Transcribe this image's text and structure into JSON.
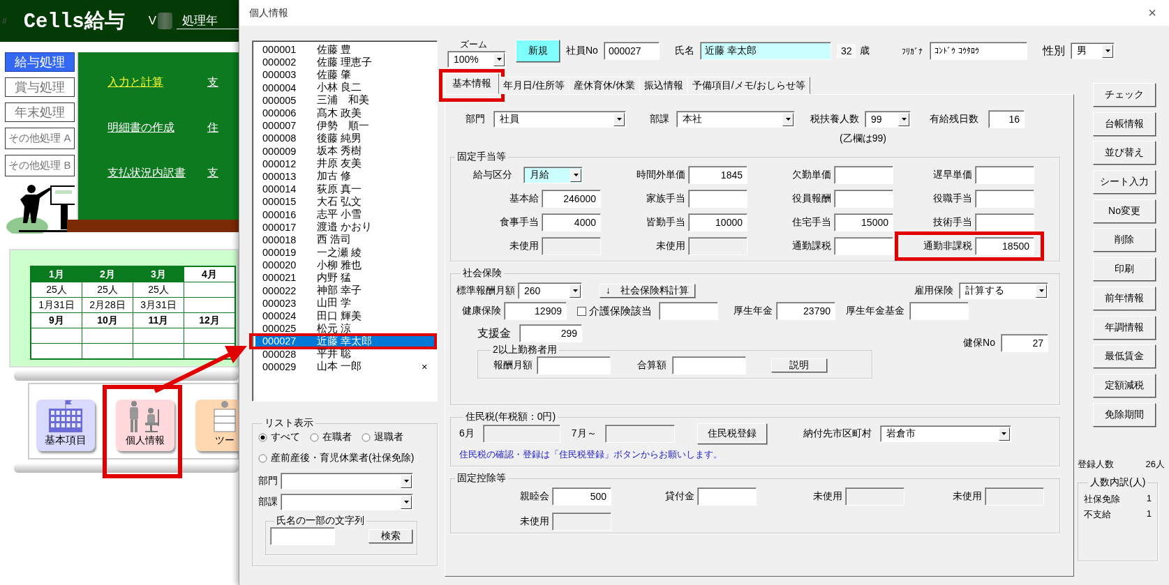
{
  "background_app": {
    "corner_mark": "#",
    "title": "Cells給与",
    "version": "V",
    "year_label": "処理年",
    "menu": [
      {
        "label": "給与処理",
        "selected": true
      },
      {
        "label": "賞与処理",
        "selected": false
      },
      {
        "label": "年末処理",
        "selected": false
      },
      {
        "label": "その他処理 A",
        "selected": false
      },
      {
        "label": "その他処理 B",
        "selected": false
      }
    ],
    "board_links": [
      {
        "label": "入力と計算",
        "selected": true
      },
      {
        "label": "支",
        "selected": false
      },
      {
        "label": "明細書の作成",
        "selected": false
      },
      {
        "label": "住",
        "selected": false
      },
      {
        "label": "支払状況内訳書",
        "selected": false
      },
      {
        "label": "支",
        "selected": false
      }
    ],
    "calendar": {
      "blocks": [
        {
          "months": [
            {
              "label": "1月",
              "done": true
            },
            {
              "label": "2月",
              "done": true
            },
            {
              "label": "3月",
              "done": true
            },
            {
              "label": "4月",
              "done": false
            }
          ],
          "rows": [
            [
              "25人",
              "25人",
              "25人",
              null
            ],
            [
              "1月31日",
              "2月28日",
              "3月31日",
              null
            ]
          ]
        },
        {
          "months": [
            {
              "label": "9月",
              "done": false
            },
            {
              "label": "10月",
              "done": false
            },
            {
              "label": "11月",
              "done": false
            },
            {
              "label": "12月",
              "done": false
            }
          ],
          "rows": [
            [
              null,
              null,
              null,
              null
            ],
            [
              null,
              null,
              null,
              null
            ]
          ]
        }
      ]
    },
    "tiles": [
      {
        "label": "基本項目",
        "kind": "building",
        "annotated": false
      },
      {
        "label": "個人情報",
        "kind": "people",
        "annotated": true
      },
      {
        "label": "ツー",
        "kind": "worker",
        "annotated": false
      }
    ]
  },
  "dialog": {
    "title": "個人情報",
    "close": "×",
    "zoom": {
      "label": "ズーム",
      "value": "100%"
    },
    "new_button": "新規",
    "employee_no": {
      "label": "社員No",
      "value": "000027"
    },
    "name": {
      "label": "氏名",
      "value": "近藤 幸太郎"
    },
    "age": {
      "value": "32",
      "unit": "歳"
    },
    "furigana": {
      "label": "ﾌﾘｶﾞﾅ",
      "value": "ｺﾝﾄﾞｳ ｺｳﾀﾛｳ"
    },
    "gender": {
      "label": "性別",
      "value": "男"
    },
    "employee_list": {
      "selection_annotated": true,
      "items": [
        {
          "no": "000001",
          "name": "佐藤 豊",
          "selected": false
        },
        {
          "no": "000002",
          "name": "佐藤 理恵子",
          "selected": false
        },
        {
          "no": "000003",
          "name": "佐藤 肇",
          "selected": false
        },
        {
          "no": "000004",
          "name": "小林 良二",
          "selected": false
        },
        {
          "no": "000005",
          "name": "三浦　和美",
          "selected": false
        },
        {
          "no": "000006",
          "name": "髙木 政美",
          "selected": false
        },
        {
          "no": "000007",
          "name": "伊勢　順一",
          "selected": false
        },
        {
          "no": "000008",
          "name": "後藤 純男",
          "selected": false
        },
        {
          "no": "000009",
          "name": "坂本 秀樹",
          "selected": false
        },
        {
          "no": "000012",
          "name": "井原 友美",
          "selected": false
        },
        {
          "no": "000013",
          "name": "加古 修",
          "selected": false
        },
        {
          "no": "000014",
          "name": "荻原 真一",
          "selected": false
        },
        {
          "no": "000015",
          "name": "大石 弘文",
          "selected": false
        },
        {
          "no": "000016",
          "name": "志平 小雪",
          "selected": false
        },
        {
          "no": "000017",
          "name": "渡邉 かおり",
          "selected": false
        },
        {
          "no": "000018",
          "name": "西 浩司",
          "selected": false
        },
        {
          "no": "000019",
          "name": "一之瀬 綾",
          "selected": false
        },
        {
          "no": "000020",
          "name": "小柳 雅也",
          "selected": false
        },
        {
          "no": "000021",
          "name": "内野 猛",
          "selected": false
        },
        {
          "no": "000022",
          "name": "神部 幸子",
          "selected": false
        },
        {
          "no": "000023",
          "name": "山田 学",
          "selected": false
        },
        {
          "no": "000024",
          "name": "田口 輝美",
          "selected": false
        },
        {
          "no": "000025",
          "name": "松元 涼",
          "selected": false
        },
        {
          "no": "000027",
          "name": "近藤 幸太郎",
          "selected": true
        },
        {
          "no": "000028",
          "name": "平井 聡",
          "selected": false
        },
        {
          "no": "000029",
          "name": "山本 一郎",
          "mark": "×",
          "selected": false
        }
      ]
    },
    "list_filter": {
      "title": "リスト表示",
      "options": [
        {
          "label": "すべて",
          "selected": true
        },
        {
          "label": "在職者",
          "selected": false
        },
        {
          "label": "退職者",
          "selected": false
        },
        {
          "label": "産前産後・育児休業者(社保免除)",
          "selected": false
        }
      ],
      "department_label": "部門",
      "section_label": "部課",
      "search_title": "氏名の一部の文字列",
      "search_button": "検索"
    },
    "tabs": [
      {
        "label": "基本情報",
        "selected": true,
        "annotated": true
      },
      {
        "label": "年月日/住所等",
        "selected": false,
        "annotated": false
      },
      {
        "label": "産休育休/休業",
        "selected": false,
        "annotated": false
      },
      {
        "label": "振込情報",
        "selected": false,
        "annotated": false
      },
      {
        "label": "予備項目/メモ/おしらせ等",
        "selected": false,
        "annotated": false
      }
    ],
    "basic": {
      "department": {
        "label": "部門",
        "value": "社員"
      },
      "section": {
        "label": "部課",
        "value": "本社"
      },
      "dependents": {
        "label": "税扶養人数",
        "value": "99"
      },
      "paid_leave": {
        "label": "有給残日数",
        "value": "16"
      },
      "dependents_note": "(乙欄は99)"
    },
    "allowances": {
      "title": "固定手当等",
      "pay_type": {
        "label": "給与区分",
        "value": "月給"
      },
      "fields": [
        {
          "label": "時間外単価",
          "value": "1845",
          "kind": "input",
          "annotated": false
        },
        {
          "label": "欠勤単価",
          "kind": "input",
          "annotated": false
        },
        {
          "label": "遅早単価",
          "kind": "input",
          "annotated": false
        },
        {
          "label": "基本給",
          "value": "246000",
          "kind": "input",
          "annotated": false
        },
        {
          "label": "家族手当",
          "kind": "input",
          "annotated": false
        },
        {
          "label": "役員報酬",
          "kind": "input",
          "annotated": false
        },
        {
          "label": "役職手当",
          "kind": "input",
          "annotated": false
        },
        {
          "label": "食事手当",
          "value": "4000",
          "kind": "input",
          "annotated": false
        },
        {
          "label": "皆勤手当",
          "value": "10000",
          "kind": "input",
          "annotated": false
        },
        {
          "label": "住宅手当",
          "value": "15000",
          "kind": "input",
          "annotated": false
        },
        {
          "label": "技術手当",
          "kind": "input",
          "annotated": false
        },
        {
          "label": "未使用",
          "kind": "disabled",
          "annotated": false
        },
        {
          "label": "未使用",
          "kind": "disabled",
          "annotated": false
        },
        {
          "label": "通勤課税",
          "kind": "input",
          "annotated": false
        },
        {
          "label": "通勤非課税",
          "value": "18500",
          "kind": "input",
          "annotated": true
        }
      ]
    },
    "social_insurance": {
      "title": "社会保険",
      "standard_pay": {
        "label": "標準報酬月額",
        "value": "260"
      },
      "calc_button": "↓　社会保険料計算",
      "employment": {
        "label": "雇用保険",
        "value": "計算する"
      },
      "health": {
        "label": "健康保険",
        "value": "12909"
      },
      "care": {
        "label": "介護保険該当",
        "checked": false
      },
      "pension": {
        "label": "厚生年金",
        "value": "23790"
      },
      "pension_fund": {
        "label": "厚生年金基金"
      },
      "support": {
        "label": "支援金",
        "value": "299"
      },
      "insurer_no": {
        "label": "健保No",
        "value": "27"
      },
      "multi_work": {
        "title": "2以上勤務者用",
        "pay_label": "報酬月額",
        "total_label": "合算額",
        "button": "説明"
      }
    },
    "resident_tax": {
      "title": "住民税(年税額：0円)",
      "june_label": "6月",
      "july_label": "7月～",
      "button": "住民税登録",
      "city": {
        "label": "納付先市区町村",
        "value": "岩倉市"
      },
      "note": "住民税の確認・登録は「住民税登録」ボタンからお願いします。"
    },
    "deductions": {
      "title": "固定控除等",
      "fields": [
        {
          "label": "親睦会",
          "value": "500",
          "kind": "input"
        },
        {
          "label": "貸付金",
          "kind": "input"
        },
        {
          "label": "未使用",
          "kind": "disabled"
        },
        {
          "label": "未使用",
          "kind": "disabled"
        },
        {
          "label": "未使用",
          "kind": "disabled"
        }
      ]
    },
    "side_buttons": [
      "チェック",
      "台帳情報",
      "並び替え",
      "シート入力",
      "No変更",
      "削除",
      "印刷",
      "前年情報",
      "年調情報",
      "最低賃金",
      "定額減税",
      "免除期間"
    ],
    "headcount": {
      "label": "登録人数",
      "value": "26人"
    },
    "breakdown": {
      "title": "人数内訳(人)",
      "rows": [
        {
          "label": "社保免除",
          "value": "1"
        },
        {
          "label": "不支給",
          "value": "1"
        }
      ]
    }
  }
}
